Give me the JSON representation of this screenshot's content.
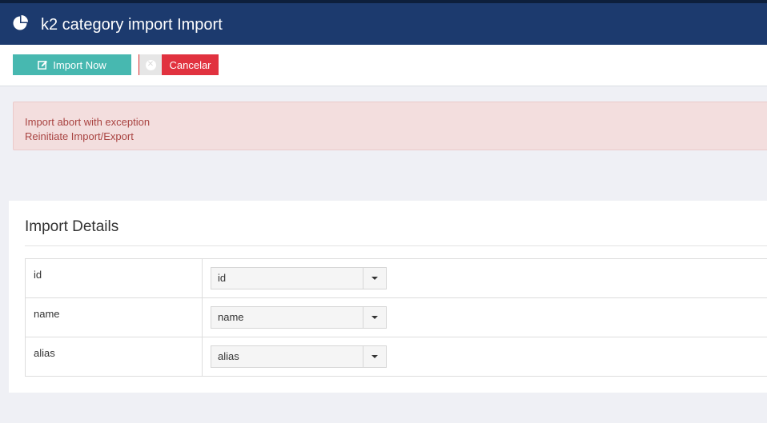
{
  "header": {
    "title": "k2 category import Import",
    "logo_icon": "pie-chart-icon",
    "background": "#1c3a6e"
  },
  "toolbar": {
    "import_label": "Import Now",
    "import_icon": "edit-icon",
    "cancel_label": "Cancelar",
    "cancel_icon": "close-circle-icon",
    "import_color": "#47b8b0",
    "cancel_color": "#e1323f"
  },
  "alert": {
    "lines": [
      "Import abort with exception",
      "Reinitiate Import/Export"
    ]
  },
  "details": {
    "title": "Import Details",
    "rows": [
      {
        "field": "id",
        "selected": "id"
      },
      {
        "field": "name",
        "selected": "name"
      },
      {
        "field": "alias",
        "selected": "alias"
      }
    ]
  }
}
